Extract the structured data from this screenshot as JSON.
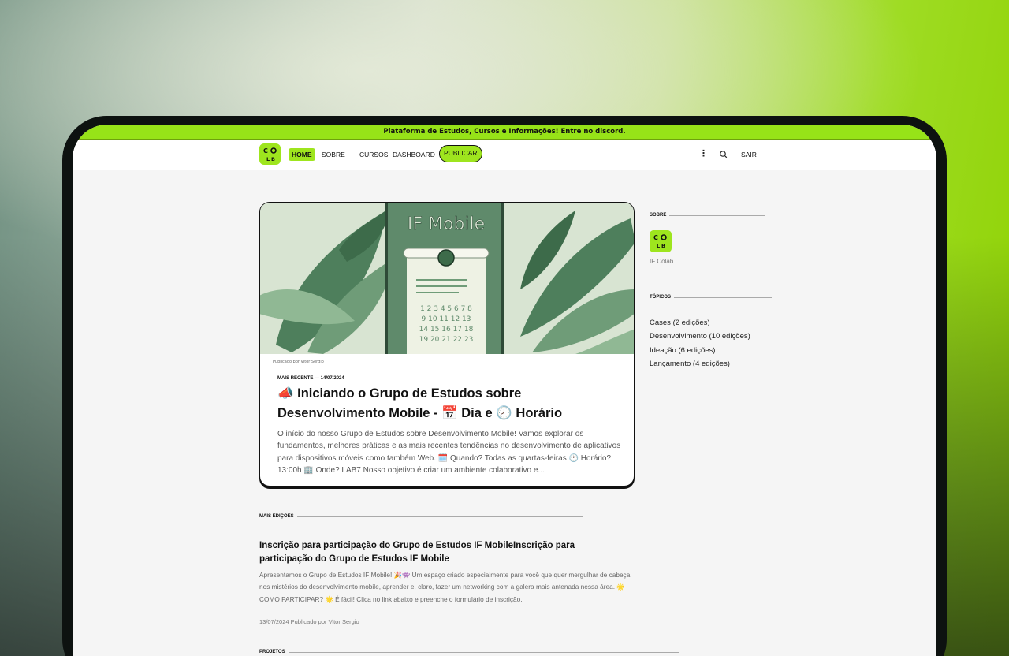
{
  "announcement": "Plataforma de Estudos, Cursos e Informações! Entre no discord.",
  "brand": {
    "logo_text": "C O L B"
  },
  "nav": {
    "home": "HOME",
    "sobre": "SOBRE",
    "cursos": "CURSOS",
    "dashboard": "DASHBOARD",
    "publicar": "PUBLICAR",
    "more_icon": "more-vertical-icon",
    "search_icon": "search-icon",
    "sair": "SAIR"
  },
  "featured": {
    "hero_title": "IF Mobile",
    "hero_calendar": [
      "1 2 3 4 5 6 7 8",
      "9 10 11 12 13",
      "14 15 16 17 18",
      "19 20 21 22 23"
    ],
    "byline": "Publicado por Vitor Sergio",
    "tag": "MAIS RECENTE — 14/07/2024",
    "title": "📣 Iniciando o Grupo de Estudos sobre Desenvolvimento Mobile - 📅 Dia e 🕗 Horário",
    "excerpt": "O início do nosso Grupo de Estudos sobre Desenvolvimento Mobile! Vamos explorar os fundamentos, melhores práticas e as mais recentes tendências no desenvolvimento de aplicativos para dispositivos móveis como também Web. 🗓️ Quando? Todas as quartas-feiras 🕐 Horário? 13:00h 🏢 Onde? LAB7 Nosso objetivo é criar um ambiente colaborativo e..."
  },
  "more_editions": {
    "heading": "MAIS EDIÇÕES",
    "items": [
      {
        "title": "Inscrição para participação do Grupo de Estudos IF MobileInscrição para participação do Grupo de Estudos IF Mobile",
        "excerpt": "Apresentamos o Grupo de Estudos IF Mobile! 🎉👾 Um espaço criado especialmente para você que quer mergulhar de cabeça nos mistérios do desenvolvimento mobile, aprender e, claro, fazer um networking com a galera mais antenada nessa área. 🌟 COMO PARTICIPAR? 🌟 É fácil! Clica no link abaixo e preenche o formulário de inscrição.",
        "meta": "13/07/2024 Publicado por Vitor Sergio"
      }
    ]
  },
  "projects": {
    "heading": "PROJETOS"
  },
  "sidebar": {
    "about_heading": "SOBRE",
    "about_name": "IF Colab...",
    "topics_heading": "TÓPICOS",
    "topics": [
      "Cases (2 edições)",
      "Desenvolvimento (10 edições)",
      "Ideação (6 edições)",
      "Lançamento (4 edições)"
    ]
  },
  "colors": {
    "accent": "#9ee51e",
    "hero_green": "#5f8a6b"
  }
}
